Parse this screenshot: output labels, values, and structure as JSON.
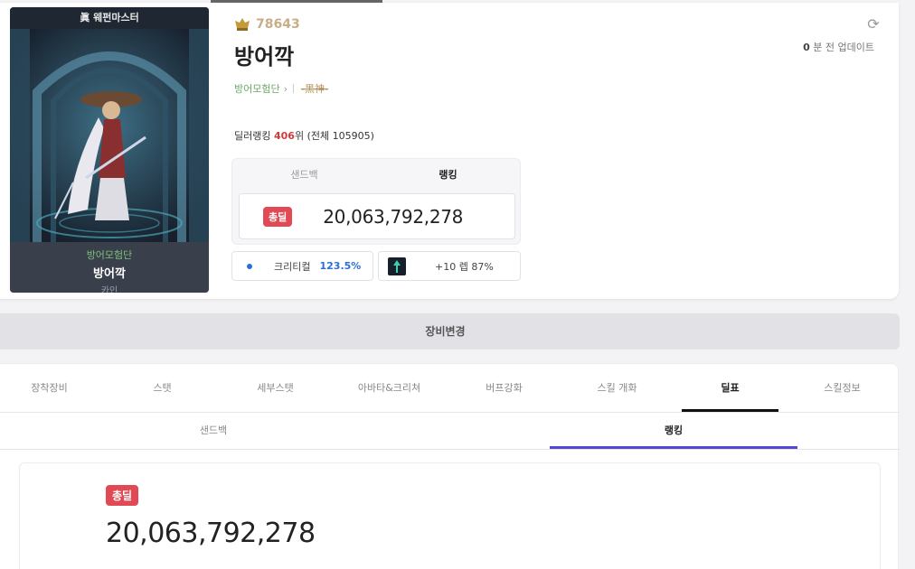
{
  "character": {
    "card_title": "眞 웨펀마스터",
    "guild": "방어모험단",
    "name": "방어깍",
    "server": "카인"
  },
  "profile": {
    "fame": "78643",
    "name": "방어깍",
    "guild_link": "방어모험단",
    "adventure_name": "-黑神-",
    "update_count": "0",
    "update_suffix": "분 전 업데이트",
    "ranking_prefix": "딜러랭킹",
    "ranking_value": "406",
    "ranking_suffix": "위 (전체 105905)"
  },
  "score_box": {
    "tabs": [
      {
        "label": "샌드백",
        "active": false
      },
      {
        "label": "랭킹",
        "active": true
      }
    ],
    "badge": "총딜",
    "value": "20,063,792,278"
  },
  "critical": {
    "label": "크리티컬",
    "value": "123.5%"
  },
  "reinforce": {
    "text": "+10 렙 87%"
  },
  "equip_change_label": "장비변경",
  "main_tabs": [
    {
      "label": "장착장비",
      "active": false
    },
    {
      "label": "스탯",
      "active": false
    },
    {
      "label": "세부스탯",
      "active": false
    },
    {
      "label": "아바타&크리쳐",
      "active": false
    },
    {
      "label": "버프강화",
      "active": false
    },
    {
      "label": "스킬 개화",
      "active": false
    },
    {
      "label": "딜표",
      "active": true
    },
    {
      "label": "스킬정보",
      "active": false
    }
  ],
  "sub_tabs": [
    {
      "label": "샌드백",
      "active": false
    },
    {
      "label": "랭킹",
      "active": true
    }
  ],
  "result": {
    "badge": "총딜",
    "value": "20,063,792,278"
  },
  "colors": {
    "accent_red": "#e14a54",
    "accent_purple": "#5447d6",
    "critical_blue": "#2a6fd6",
    "guild_green": "#6aa86a"
  }
}
